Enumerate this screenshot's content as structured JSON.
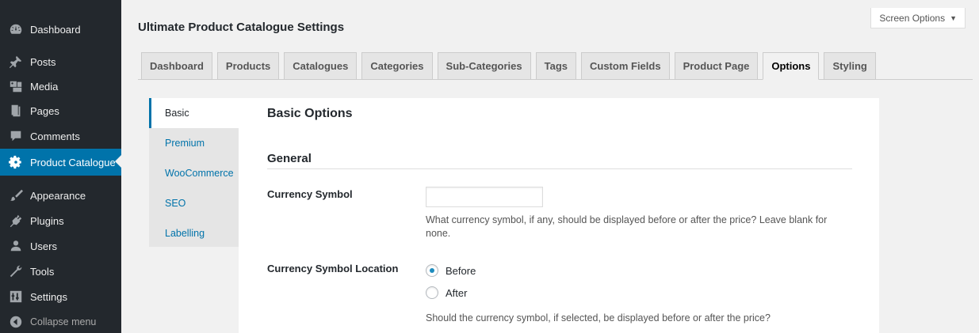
{
  "sidebar": {
    "items": [
      {
        "label": "Dashboard",
        "icon": "dashboard-icon"
      },
      {
        "label": "Posts",
        "icon": "pin-icon"
      },
      {
        "label": "Media",
        "icon": "media-icon"
      },
      {
        "label": "Pages",
        "icon": "pages-icon"
      },
      {
        "label": "Comments",
        "icon": "comments-icon"
      },
      {
        "label": "Product Catalogue",
        "icon": "gear-icon",
        "active": true
      },
      {
        "label": "Appearance",
        "icon": "brush-icon"
      },
      {
        "label": "Plugins",
        "icon": "plug-icon"
      },
      {
        "label": "Users",
        "icon": "users-icon"
      },
      {
        "label": "Tools",
        "icon": "wrench-icon"
      },
      {
        "label": "Settings",
        "icon": "settings-icon"
      }
    ],
    "collapse_label": "Collapse menu"
  },
  "screen_options": {
    "label": "Screen Options",
    "arrow": "▼"
  },
  "page_title": "Ultimate Product Catalogue Settings",
  "tabs": [
    {
      "label": "Dashboard"
    },
    {
      "label": "Products"
    },
    {
      "label": "Catalogues"
    },
    {
      "label": "Categories"
    },
    {
      "label": "Sub-Categories"
    },
    {
      "label": "Tags"
    },
    {
      "label": "Custom Fields"
    },
    {
      "label": "Product Page"
    },
    {
      "label": "Options",
      "active": true
    },
    {
      "label": "Styling"
    }
  ],
  "subnav": [
    {
      "label": "Basic",
      "active": true
    },
    {
      "label": "Premium"
    },
    {
      "label": "WooCommerce"
    },
    {
      "label": "SEO"
    },
    {
      "label": "Labelling"
    }
  ],
  "panel": {
    "title": "Basic Options",
    "section": "General",
    "currency_symbol": {
      "label": "Currency Symbol",
      "value": "",
      "description_line1": "What currency symbol, if any, should be displayed before or after the price? Leave blank for",
      "description_line2": "none."
    },
    "currency_location": {
      "label": "Currency Symbol Location",
      "options": [
        "Before",
        "After"
      ],
      "selected": "Before",
      "description": "Should the currency symbol, if selected, be displayed before or after the price?"
    }
  },
  "colors": {
    "accent": "#0073aa",
    "sidebar_bg": "#23282d",
    "page_bg": "#f1f1f1"
  }
}
